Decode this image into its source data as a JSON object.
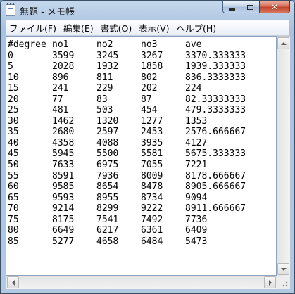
{
  "window": {
    "title": "無題 - メモ帳",
    "icon": "notepad-icon",
    "controls": {
      "minimize": "minimize-icon",
      "maximize": "maximize-icon",
      "close": "close-icon",
      "close_glyph": "✕"
    },
    "colors": {
      "close": "#c0432a",
      "frame": "#b4cbe4"
    }
  },
  "menu": [
    {
      "label": "ファイル(F)"
    },
    {
      "label": "編集(E)"
    },
    {
      "label": "書式(O)"
    },
    {
      "label": "表示(V)"
    },
    {
      "label": "ヘルプ(H)"
    }
  ],
  "document": {
    "header": [
      "#degree",
      "no1",
      "no2",
      "no3",
      "ave"
    ],
    "rows": [
      [
        "0",
        "3599",
        "3245",
        "3267",
        "3370.333333"
      ],
      [
        "5",
        "2028",
        "1932",
        "1858",
        "1939.333333"
      ],
      [
        "10",
        "896",
        "811",
        "802",
        "836.3333333"
      ],
      [
        "15",
        "241",
        "229",
        "202",
        "224"
      ],
      [
        "20",
        "77",
        "83",
        "87",
        "82.33333333"
      ],
      [
        "25",
        "481",
        "503",
        "454",
        "479.3333333"
      ],
      [
        "30",
        "1462",
        "1320",
        "1277",
        "1353"
      ],
      [
        "35",
        "2680",
        "2597",
        "2453",
        "2576.666667"
      ],
      [
        "40",
        "4358",
        "4088",
        "3935",
        "4127"
      ],
      [
        "45",
        "5945",
        "5500",
        "5581",
        "5675.333333"
      ],
      [
        "50",
        "7633",
        "6975",
        "7055",
        "7221"
      ],
      [
        "55",
        "8591",
        "7936",
        "8009",
        "8178.666667"
      ],
      [
        "60",
        "9585",
        "8654",
        "8478",
        "8905.666667"
      ],
      [
        "65",
        "9593",
        "8955",
        "8734",
        "9094"
      ],
      [
        "70",
        "9214",
        "8299",
        "9222",
        "8911.666667"
      ],
      [
        "75",
        "8175",
        "7541",
        "7492",
        "7736"
      ],
      [
        "80",
        "6649",
        "6217",
        "6361",
        "6409"
      ],
      [
        "85",
        "5277",
        "4658",
        "6484",
        "5473"
      ]
    ]
  }
}
